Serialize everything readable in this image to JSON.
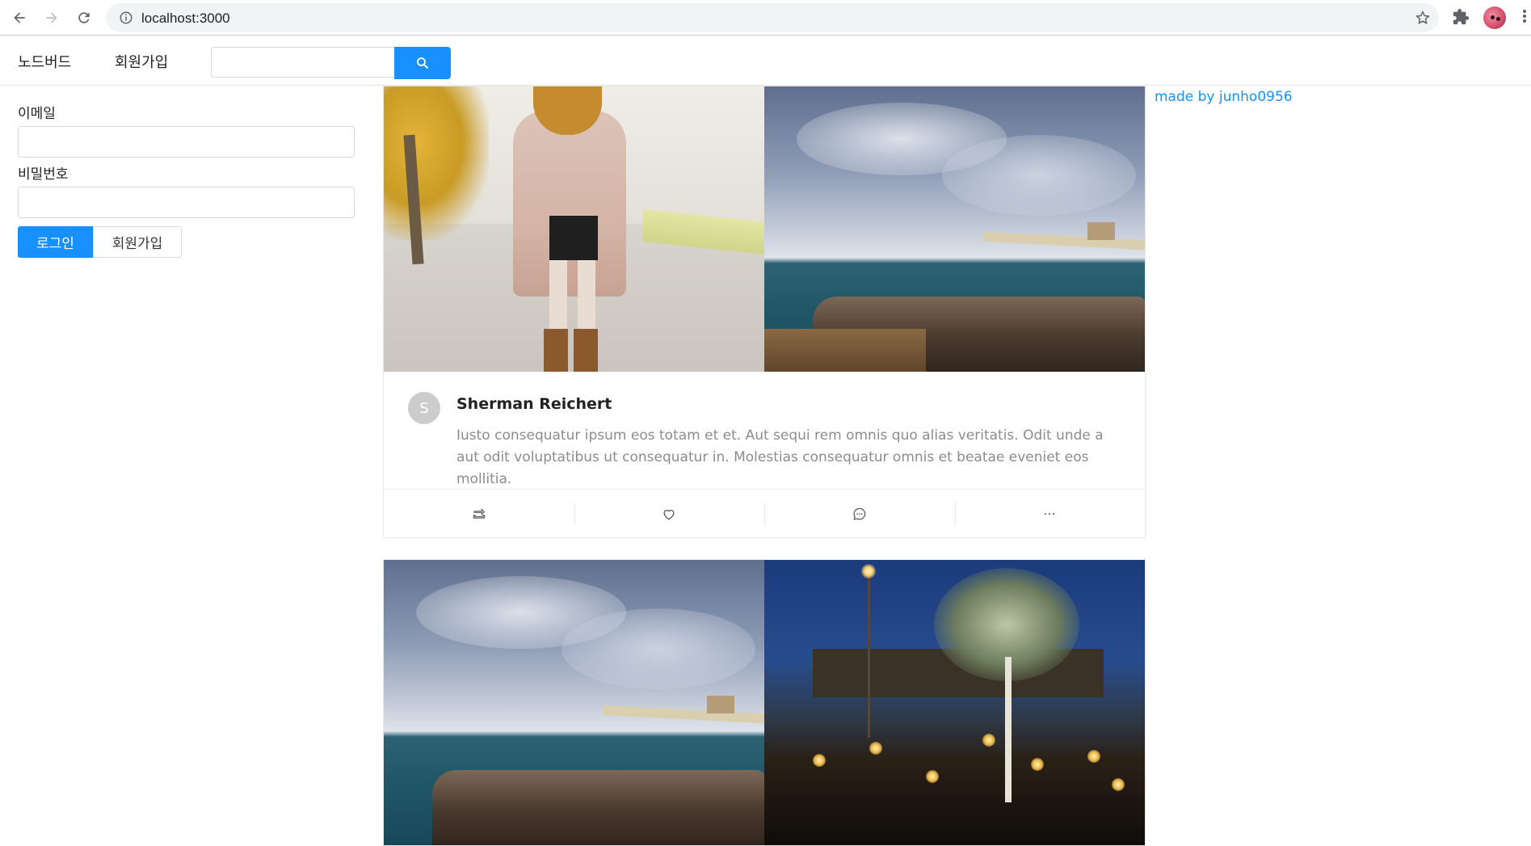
{
  "browser": {
    "url": "localhost:3000",
    "icons": [
      "back-icon",
      "forward-icon",
      "reload-icon",
      "info-icon",
      "star-icon",
      "extensions-icon",
      "profile-avatar",
      "menu-icon"
    ]
  },
  "header": {
    "brand": "노드버드",
    "signup_link": "회원가입",
    "search_placeholder": "",
    "search_icon": "search-icon"
  },
  "login": {
    "email_label": "이메일",
    "email_value": "",
    "password_label": "비밀번호",
    "password_value": "",
    "login_button": "로그인",
    "signup_button": "회원가입"
  },
  "posts": [
    {
      "avatar_letter": "S",
      "author": "Sherman Reichert",
      "content": "Iusto consequatur ipsum eos totam et et. Aut sequi rem omnis quo alias veritatis. Odit unde a aut odit voluptatibus ut consequatur in. Molestias consequatur omnis et beatae eveniet eos mollitia.",
      "actions": [
        "retweet-icon",
        "heart-icon",
        "message-icon",
        "ellipsis-icon"
      ]
    }
  ],
  "credit": "made by junho0956",
  "colors": {
    "primary": "#1890ff",
    "border": "#e8e8e8",
    "muted_text": "#8c8c8c",
    "avatar_bg": "#cccccc"
  }
}
